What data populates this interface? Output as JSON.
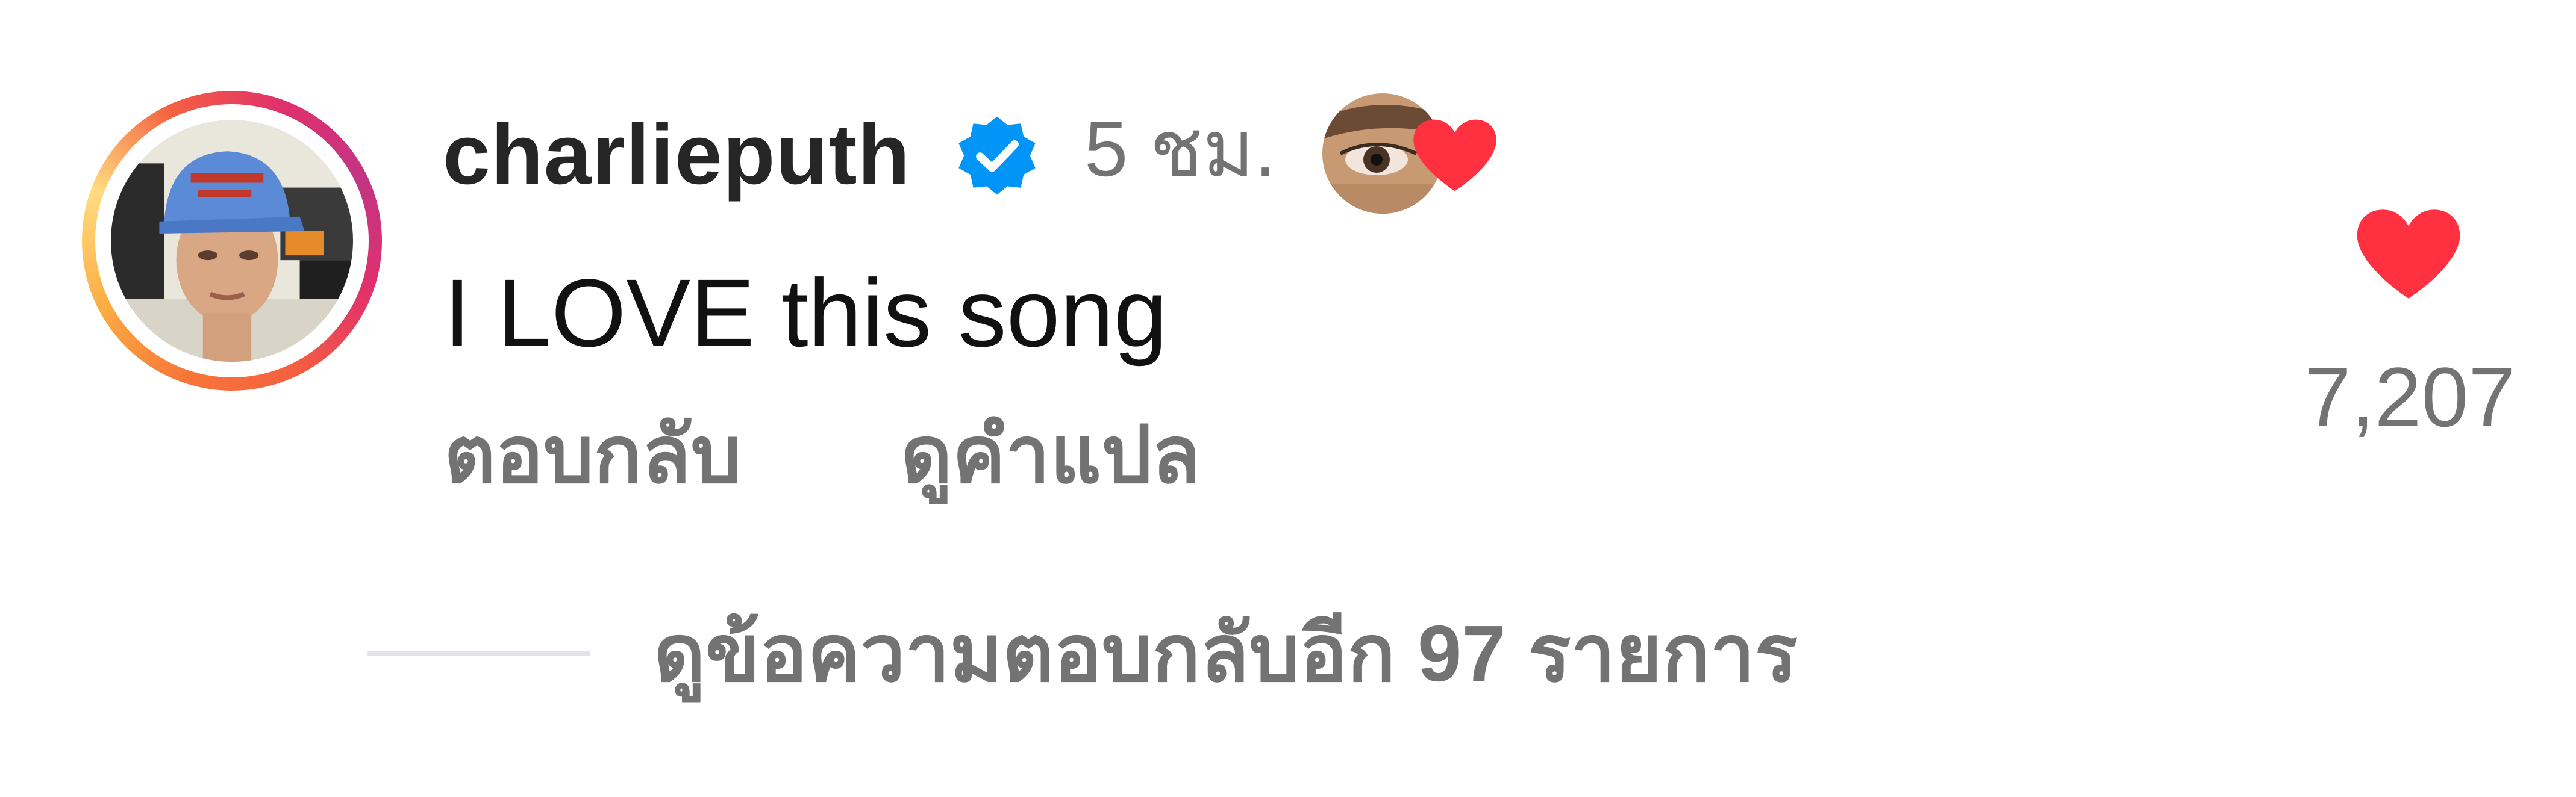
{
  "comment": {
    "username": "charlieputh",
    "timestamp": "5 ชม.",
    "text": "I LOVE this song",
    "reply_label": "ตอบกลับ",
    "translate_label": "ดูคำแปล",
    "verified": true,
    "liked_by_author": true
  },
  "like": {
    "count": "7,207",
    "liked": true,
    "color": "#ff3040"
  },
  "replies": {
    "view_label": "ดูข้อความตอบกลับอีก 97 รายการ"
  },
  "colors": {
    "text_primary": "#262626",
    "text_secondary": "#737373",
    "verified_blue": "#0095f6",
    "heart_red": "#ff3040",
    "divider": "#e3e3ea"
  },
  "icons": {
    "verified": "verified-badge-icon",
    "like": "heart-icon",
    "author_like": "heart-icon"
  }
}
